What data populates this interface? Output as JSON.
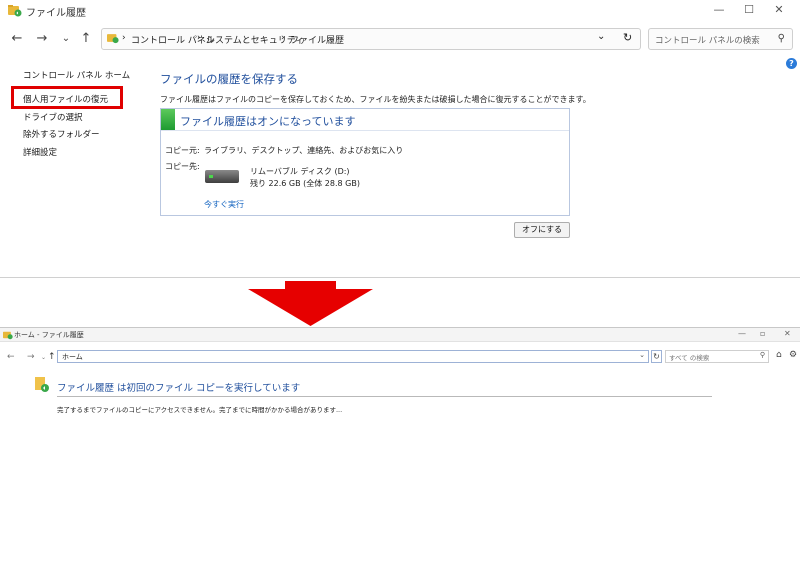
{
  "top_window": {
    "title": "ファイル履歴",
    "breadcrumb": [
      "コントロール パネル",
      "システムとセキュリティ",
      "ファイル履歴"
    ],
    "search_placeholder": "コントロール パネルの検索",
    "sidebar": {
      "items": [
        {
          "label": "コントロール パネル ホーム"
        },
        {
          "label": "個人用ファイルの復元",
          "highlighted": true
        },
        {
          "label": "ドライブの選択"
        },
        {
          "label": "除外するフォルダー"
        },
        {
          "label": "詳細設定"
        }
      ]
    },
    "heading": "ファイルの履歴を保存する",
    "description": "ファイル履歴はファイルのコピーを保存しておくため、ファイルを紛失または破損した場合に復元することができます。",
    "status_panel": {
      "status": "ファイル履歴はオンになっています",
      "copy_from_label": "コピー元:",
      "copy_from_value": "ライブラリ、デスクトップ、連絡先、およびお気に入り",
      "copy_to_label": "コピー先:",
      "drive_name": "リムーバブル ディスク (D:)",
      "drive_space": "残り 22.6 GB (全体 28.8 GB)",
      "run_now": "今すぐ実行"
    },
    "off_button": "オフにする",
    "highlight_color": "#e00000"
  },
  "bottom_window": {
    "title": "ホーム - ファイル履歴",
    "address": "ホーム",
    "search_placeholder": "すべて の検索",
    "heading": "ファイル履歴 は初回のファイル コピーを実行しています",
    "message": "完了するまでファイルのコピーにアクセスできません。完了までに時間がかかる場合があります..."
  },
  "colors": {
    "heading_blue": "#1f4e9c",
    "link_blue": "#1565c0",
    "arrow_red": "#e60000",
    "status_green": "#1e9b30"
  }
}
